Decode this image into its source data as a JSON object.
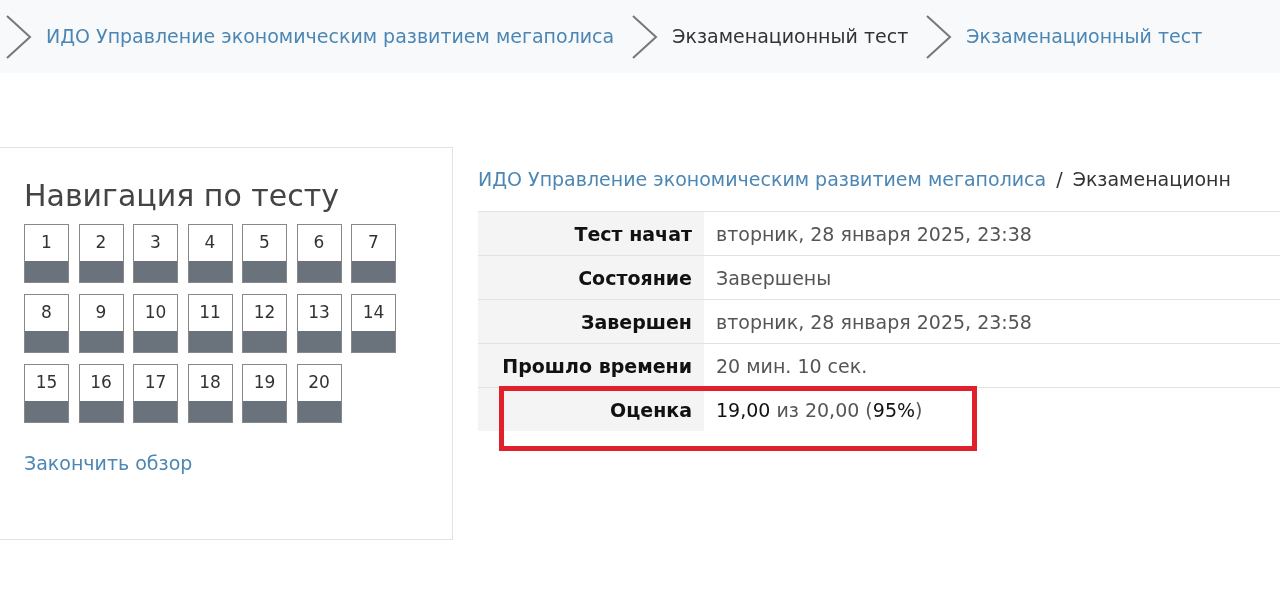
{
  "breadcrumb": [
    {
      "label": "ИДО Управление экономическим развитием мегаполиса",
      "kind": "link"
    },
    {
      "label": "Экзаменационный тест",
      "kind": "current"
    },
    {
      "label": "Экзаменационный тест",
      "kind": "link"
    }
  ],
  "navigation": {
    "title": "Навигация по тесту",
    "questions": [
      "1",
      "2",
      "3",
      "4",
      "5",
      "6",
      "7",
      "8",
      "9",
      "10",
      "11",
      "12",
      "13",
      "14",
      "15",
      "16",
      "17",
      "18",
      "19",
      "20"
    ],
    "finish_link": "Закончить обзор"
  },
  "path": {
    "link": "ИДО Управление экономическим развитием мегаполиса",
    "separator": "/",
    "rest": "Экзаменационн"
  },
  "summary": [
    {
      "label": "Тест начат",
      "value": "вторник, 28 января 2025, 23:38",
      "highlighted": false
    },
    {
      "label": "Состояние",
      "value": "Завершены",
      "highlighted": false
    },
    {
      "label": "Завершен",
      "value": "вторник, 28 января 2025, 23:58",
      "highlighted": false
    },
    {
      "label": "Прошло времени",
      "value": "20 мин. 10 сек.",
      "highlighted": false
    },
    {
      "label": "Оценка",
      "value": "**19,00** из 20,00 (**95%**)",
      "highlighted": true
    }
  ]
}
